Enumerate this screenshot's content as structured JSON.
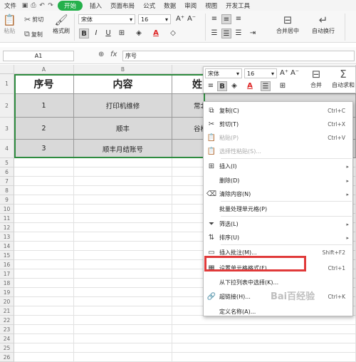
{
  "menubar": {
    "file": "文件",
    "tabs": [
      "开始",
      "插入",
      "页面布局",
      "公式",
      "数据",
      "审阅",
      "视图",
      "开发工具"
    ]
  },
  "ribbon": {
    "paste": "粘贴",
    "cut": "剪切",
    "copy": "复制",
    "format_painter": "格式刷",
    "font_name": "宋体",
    "font_size": "16",
    "bold": "B",
    "italic": "I",
    "underline": "U",
    "merge_center": "合并居中",
    "auto_wrap": "自动换行",
    "grow_font": "A⁺",
    "shrink_font": "A⁻"
  },
  "formula_bar": {
    "name_box": "A1",
    "fx": "fx",
    "formula": "序号"
  },
  "sheet": {
    "columns": [
      "A",
      "B",
      "C"
    ],
    "rows": [
      "1",
      "2",
      "3",
      "4",
      "5",
      "6",
      "7",
      "8",
      "9",
      "10",
      "11",
      "12",
      "13",
      "14",
      "15",
      "16",
      "17",
      "18",
      "19",
      "20",
      "21",
      "22",
      "23",
      "24",
      "25",
      "26"
    ],
    "header": [
      "序号",
      "内容",
      "姓"
    ],
    "data": [
      [
        "1",
        "打印机维修",
        "常北"
      ],
      [
        "2",
        "顺丰",
        "谷松"
      ],
      [
        "3",
        "顺丰月结账号",
        ""
      ]
    ]
  },
  "mini_toolbar": {
    "font_name": "宋体",
    "font_size": "16",
    "bold": "B",
    "merge": "合并",
    "autosum": "自动求和",
    "font_color_letter": "A"
  },
  "context_menu": {
    "items": [
      {
        "label": "复制(C)",
        "shortcut": "Ctrl+C",
        "icon": "copy-icon"
      },
      {
        "label": "剪切(T)",
        "shortcut": "Ctrl+X",
        "icon": "scissors-icon"
      },
      {
        "label": "粘贴(P)",
        "shortcut": "Ctrl+V",
        "icon": "paste-icon"
      },
      {
        "label": "选择性粘贴(S)...",
        "shortcut": "",
        "icon": "paste-special-icon"
      },
      {
        "label": "插入(I)",
        "shortcut": "",
        "icon": "insert-icon"
      },
      {
        "label": "删除(D)",
        "shortcut": "",
        "icon": ""
      },
      {
        "label": "清除内容(N)",
        "shortcut": "",
        "icon": "eraser-icon"
      },
      {
        "label": "批量处理单元格(P)",
        "shortcut": "",
        "icon": ""
      },
      {
        "label": "筛选(L)",
        "shortcut": "",
        "icon": "filter-icon"
      },
      {
        "label": "排序(U)",
        "shortcut": "",
        "icon": "sort-icon"
      },
      {
        "label": "插入批注(M)...",
        "shortcut": "Shift+F2",
        "icon": "comment-icon"
      },
      {
        "label": "设置单元格格式(F)...",
        "shortcut": "Ctrl+1",
        "icon": "format-cells-icon"
      },
      {
        "label": "从下拉列表中选择(K)...",
        "shortcut": "",
        "icon": ""
      },
      {
        "label": "超链接(H)...",
        "shortcut": "Ctrl+K",
        "icon": "link-icon"
      },
      {
        "label": "定义名称(A)...",
        "shortcut": "",
        "icon": ""
      }
    ]
  },
  "watermark": "Bai百经验",
  "colors": {
    "accent": "#25b04b",
    "selection": "#2e8b3f",
    "highlight_box": "#e03a3a"
  }
}
